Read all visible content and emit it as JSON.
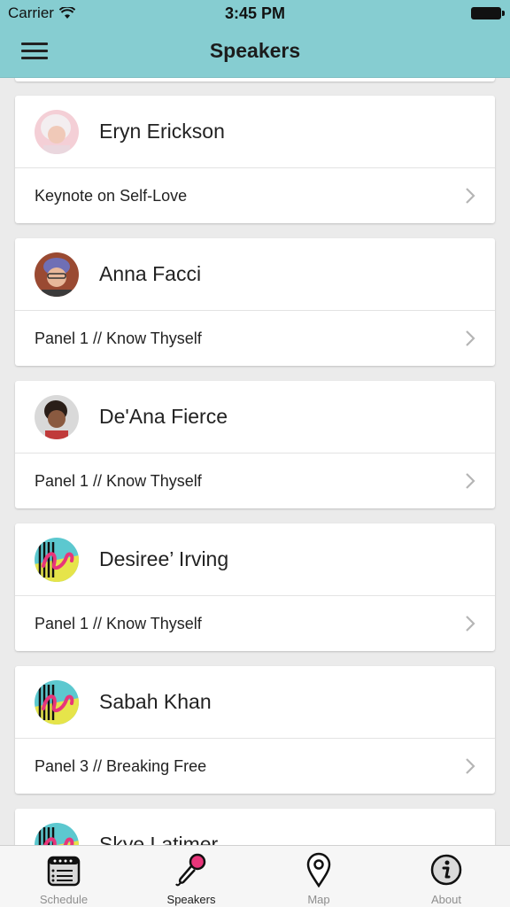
{
  "status": {
    "carrier": "Carrier",
    "time": "3:45 PM"
  },
  "nav": {
    "title": "Speakers"
  },
  "speakers": [
    {
      "name": "Eryn Erickson",
      "session": "Keynote on Self-Love",
      "avatar": "photo"
    },
    {
      "name": "Anna Facci",
      "session": "Panel 1 // Know Thyself",
      "avatar": "photo"
    },
    {
      "name": "De'Ana Fierce",
      "session": "Panel 1 // Know Thyself",
      "avatar": "photo"
    },
    {
      "name": "Desiree’ Irving",
      "session": "Panel 1 // Know Thyself",
      "avatar": "logo"
    },
    {
      "name": "Sabah Khan",
      "session": "Panel 3 // Breaking Free",
      "avatar": "logo"
    },
    {
      "name": "Skye Latimer",
      "session": "",
      "avatar": "logo"
    }
  ],
  "tabs": [
    {
      "label": "Schedule",
      "icon": "calendar-icon",
      "active": false
    },
    {
      "label": "Speakers",
      "icon": "microphone-icon",
      "active": true
    },
    {
      "label": "Map",
      "icon": "map-pin-icon",
      "active": false
    },
    {
      "label": "About",
      "icon": "info-icon",
      "active": false
    }
  ],
  "colors": {
    "header": "#86cdd1",
    "accent_pink": "#e8357a",
    "logo_teal": "#5cc8cf",
    "logo_yellow": "#e6e44a"
  }
}
